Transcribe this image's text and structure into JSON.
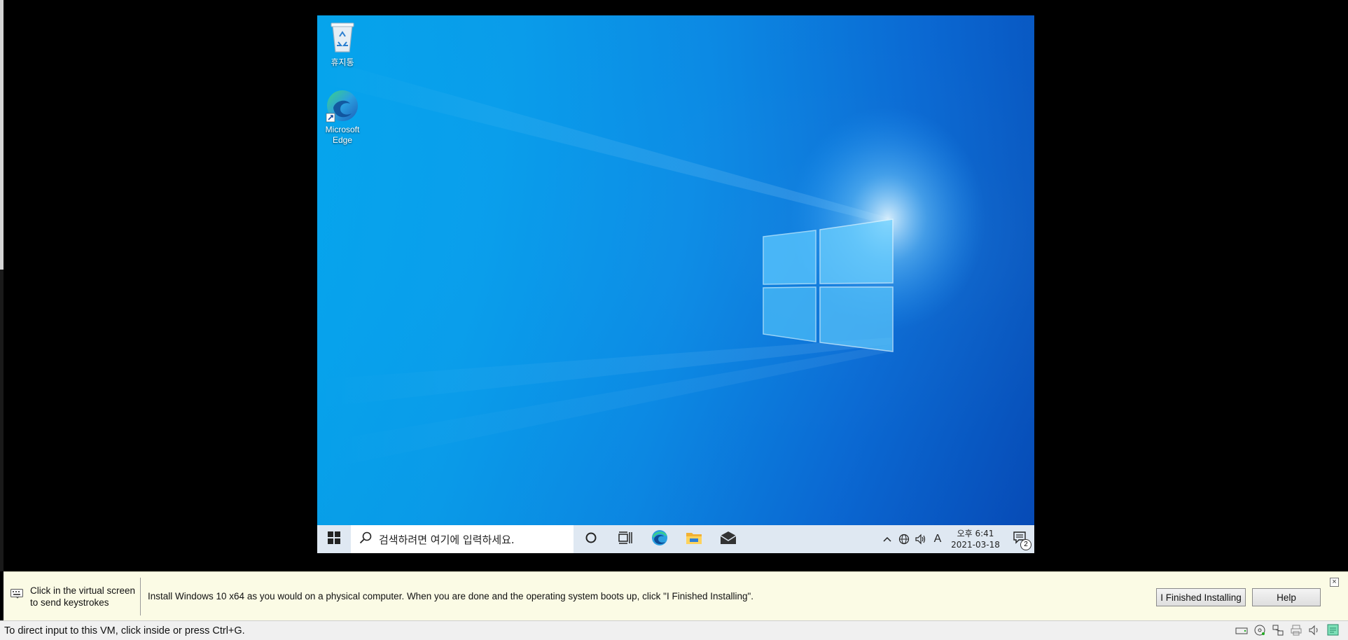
{
  "desktop": {
    "icons": [
      {
        "label": "휴지통",
        "icon": "recycle-bin-icon"
      },
      {
        "label": "Microsoft\nEdge",
        "icon": "edge-icon"
      }
    ]
  },
  "taskbar": {
    "search_placeholder": "검색하려면 여기에 입력하세요.",
    "clock_ampm_time": "오후 6:41",
    "clock_date": "2021-03-18",
    "ime_label": "A",
    "notification_count": "2"
  },
  "infobar": {
    "click_hint_line1": "Click in the virtual screen",
    "click_hint_line2": "to send keystrokes",
    "message": "Install Windows 10 x64 as you would on a physical computer. When you are done and the operating system boots up, click \"I Finished Installing\".",
    "finished_button": "I Finished Installing",
    "help_button": "Help"
  },
  "statusbar": {
    "text": "To direct input to this VM, click inside or press Ctrl+G."
  },
  "colors": {
    "taskbar_bg": "#dfe8f2",
    "infobar_bg": "#fbfbe5",
    "statusbar_bg": "#f0f0f0"
  }
}
